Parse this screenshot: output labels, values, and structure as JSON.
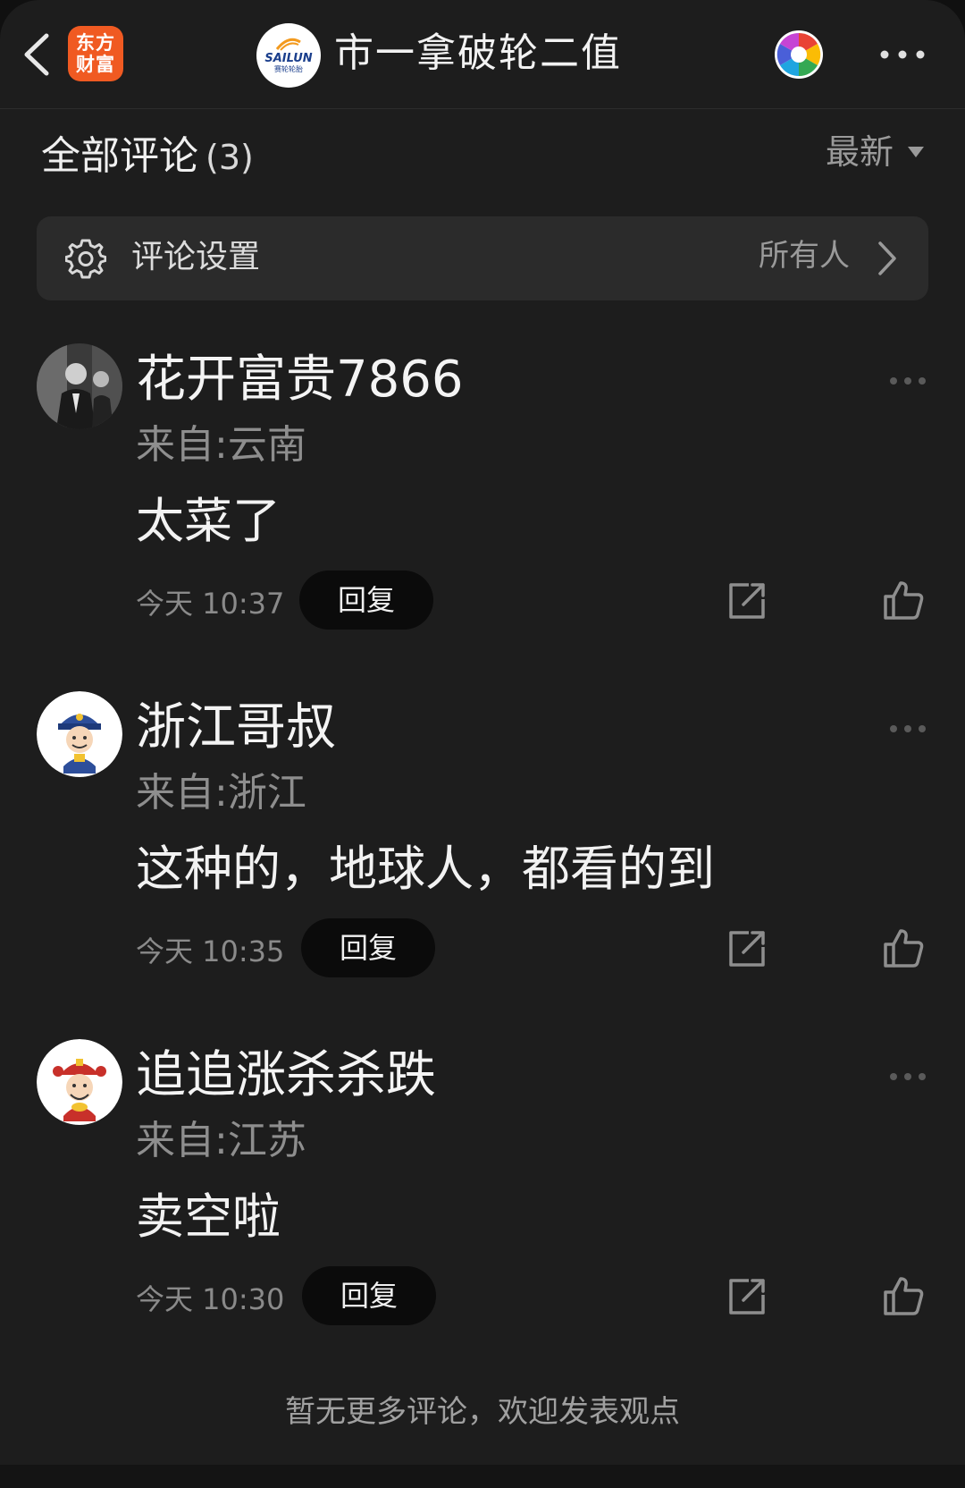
{
  "header": {
    "app_logo_line1": "东方",
    "app_logo_line2": "财富",
    "stock_logo_brand": "SAILUN",
    "stock_logo_sub": "赛轮轮胎",
    "stock_title": "市一拿破轮二值",
    "icons": [
      "chevron-left-icon",
      "aperture-icon",
      "more-horizontal-icon"
    ]
  },
  "comments_header": {
    "title": "全部评论",
    "count": "(3)",
    "sort_label": "最新"
  },
  "settings": {
    "label": "评论设置",
    "value": "所有人"
  },
  "comments": [
    {
      "username": "花开富贵7866",
      "location": "来自:云南",
      "text": "太菜了",
      "time": "今天 10:37",
      "reply_label": "回复"
    },
    {
      "username": "浙江哥叔",
      "location": "来自:浙江",
      "text": "这种的，地球人，都看的到",
      "time": "今天 10:35",
      "reply_label": "回复"
    },
    {
      "username": "追追涨杀杀跌",
      "location": "来自:江苏",
      "text": "卖空啦",
      "time": "今天 10:30",
      "reply_label": "回复"
    }
  ],
  "footer": {
    "note": "暂无更多评论，欢迎发表观点"
  },
  "colors": {
    "background": "#1d1d1d",
    "app_logo": "#f05a22",
    "secondary_text": "#8e8e8e",
    "reply_button": "#0b0b0b"
  }
}
